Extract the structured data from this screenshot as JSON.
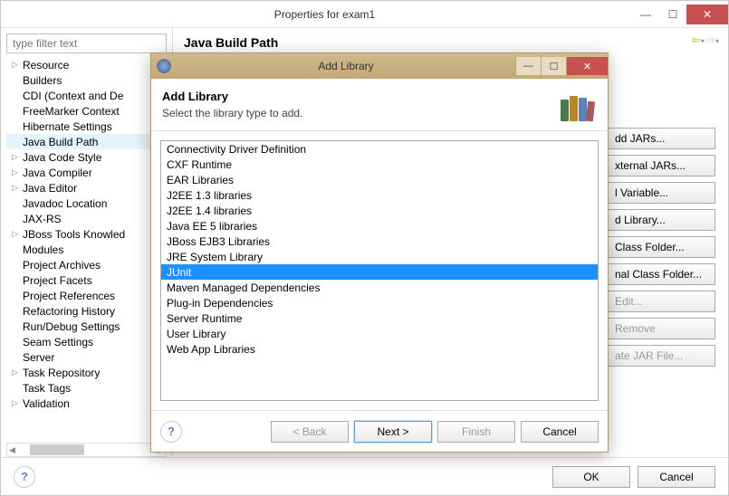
{
  "mainWindow": {
    "title": "Properties for exam1",
    "filterPlaceholder": "type filter text",
    "tree": [
      {
        "label": "Resource",
        "expandable": true
      },
      {
        "label": "Builders"
      },
      {
        "label": "CDI (Context and De"
      },
      {
        "label": "FreeMarker Context"
      },
      {
        "label": "Hibernate Settings"
      },
      {
        "label": "Java Build Path",
        "selected": true
      },
      {
        "label": "Java Code Style",
        "expandable": true
      },
      {
        "label": "Java Compiler",
        "expandable": true
      },
      {
        "label": "Java Editor",
        "expandable": true
      },
      {
        "label": "Javadoc Location"
      },
      {
        "label": "JAX-RS"
      },
      {
        "label": "JBoss Tools Knowled",
        "expandable": true
      },
      {
        "label": "Modules"
      },
      {
        "label": "Project Archives"
      },
      {
        "label": "Project Facets"
      },
      {
        "label": "Project References"
      },
      {
        "label": "Refactoring History"
      },
      {
        "label": "Run/Debug Settings"
      },
      {
        "label": "Seam Settings"
      },
      {
        "label": "Server"
      },
      {
        "label": "Task Repository",
        "expandable": true
      },
      {
        "label": "Task Tags"
      },
      {
        "label": "Validation",
        "expandable": true
      }
    ],
    "contentTitle": "Java Build Path",
    "rightButtons": [
      {
        "label": "dd JARs..."
      },
      {
        "label": "xternal JARs..."
      },
      {
        "label": "l Variable..."
      },
      {
        "label": "d Library..."
      },
      {
        "label": "Class Folder..."
      },
      {
        "label": "nal Class Folder..."
      },
      {
        "label": "Edit...",
        "disabled": true
      },
      {
        "label": "Remove",
        "disabled": true
      },
      {
        "label": "ate JAR File...",
        "disabled": true
      }
    ],
    "footer": {
      "ok": "OK",
      "cancel": "Cancel"
    }
  },
  "dialog": {
    "title": "Add Library",
    "headerTitle": "Add Library",
    "headerSub": "Select the library type to add.",
    "items": [
      "Connectivity Driver Definition",
      "CXF Runtime",
      "EAR Libraries",
      "J2EE 1.3 libraries",
      "J2EE 1.4 libraries",
      "Java EE 5 libraries",
      "JBoss EJB3 Libraries",
      "JRE System Library",
      "JUnit",
      "Maven Managed Dependencies",
      "Plug-in Dependencies",
      "Server Runtime",
      "User Library",
      "Web App Libraries"
    ],
    "selectedIndex": 8,
    "buttons": {
      "back": "< Back",
      "next": "Next >",
      "finish": "Finish",
      "cancel": "Cancel"
    }
  }
}
